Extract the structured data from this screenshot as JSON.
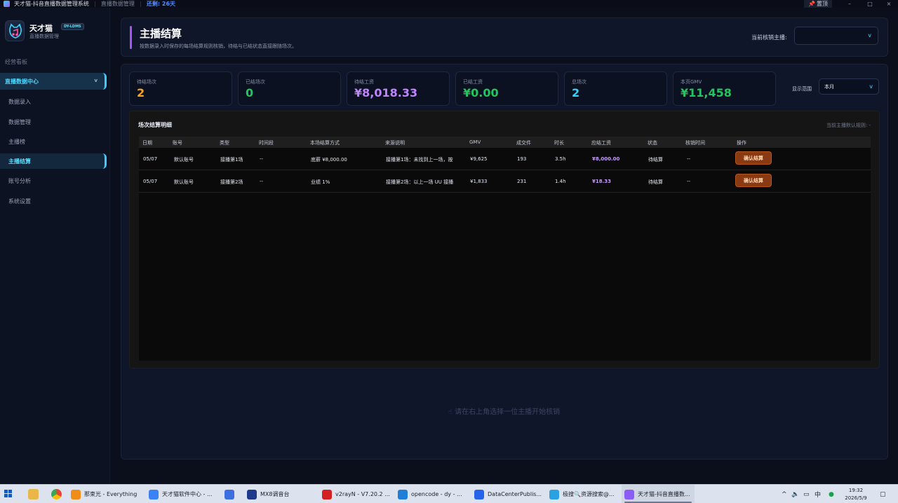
{
  "titlebar": {
    "app_title": "天才猫-抖音直播数据管理系统",
    "module": "直播数据管理",
    "remaining": "还剩: 26天",
    "pin_label": "置顶",
    "minimize": "–",
    "maximize": "□",
    "close": "×"
  },
  "brand": {
    "name": "天才猫",
    "tag": "DY-LDMS",
    "subtitle": "直播数据管理"
  },
  "sidebar": {
    "section_label": "经营看板",
    "group_label": "直播数据中心",
    "group_chevron": "v",
    "items": [
      {
        "label": "数据录入"
      },
      {
        "label": "数据管理"
      },
      {
        "label": "主播榜"
      },
      {
        "label": "主播结算"
      },
      {
        "label": "账号分析"
      },
      {
        "label": "系统设置"
      }
    ]
  },
  "header": {
    "title": "主播结算",
    "description": "按数据录入时保存的每场结算规则核销，待结与已结状态直接跟随场次。",
    "select_label": "当前核销主播:",
    "select_value": "",
    "select_caret": "v",
    "accent_color": "#a855f7"
  },
  "stats": [
    {
      "label": "待结场次",
      "value": "2",
      "color": "#f5a524"
    },
    {
      "label": "已结场次",
      "value": "0",
      "color": "#22c55e"
    },
    {
      "label": "待结工资",
      "value": "¥8,018.33",
      "color": "#c084fc"
    },
    {
      "label": "已结工资",
      "value": "¥0.00",
      "color": "#22c55e"
    },
    {
      "label": "总场次",
      "value": "2",
      "color": "#38d0f5"
    },
    {
      "label": "本页GMV",
      "value": "¥11,458",
      "color": "#22c55e"
    }
  ],
  "range": {
    "label": "显示范围",
    "value": "本月",
    "caret": "v"
  },
  "table_panel": {
    "title": "场次结算明细",
    "rule_note": "当前主播默认规则: -"
  },
  "table": {
    "columns": [
      "日期",
      "账号",
      "类型",
      "时间段",
      "本场结算方式",
      "来源说明",
      "GMV",
      "成交件",
      "时长",
      "应结工资",
      "状态",
      "核销时间",
      "操作"
    ],
    "rows": [
      {
        "date": "05/07",
        "account": "默认账号",
        "type": "接播第1场",
        "time_slot": "--",
        "method": "底薪 ¥8,000.00",
        "source": "接播第1场：未找到上一场，按",
        "gmv": "¥9,625",
        "orders": "193",
        "duration": "3.5h",
        "salary": "¥8,000.00",
        "status": "待结算",
        "verify_time": "--",
        "action": "确认结算"
      },
      {
        "date": "05/07",
        "account": "默认账号",
        "type": "接播第2场",
        "time_slot": "--",
        "method": "业绩 1%",
        "source": "接播第2场：以上一场 UU 接播",
        "gmv": "¥1,833",
        "orders": "231",
        "duration": "1.4h",
        "salary": "¥18.33",
        "status": "待结算",
        "verify_time": "--",
        "action": "确认结算"
      }
    ]
  },
  "hint": "请在右上角选择一位主播开始核销",
  "taskbar": {
    "apps": [
      {
        "label": "那束光 - Everything",
        "icon": "everything-icon",
        "color": "#f28c18"
      },
      {
        "label": "天才猫软件中心 - ...",
        "icon": "chrome-icon",
        "color": "#3b82f6"
      },
      {
        "label": "",
        "icon": "chat-icon",
        "color": "#3d6fe0"
      },
      {
        "label": "MX8调音台",
        "icon": "mixer-icon",
        "color": "#1e3a8a"
      },
      {
        "label": "v2rayN - V7.20.2 ...",
        "icon": "v2ray-icon",
        "color": "#d42020"
      },
      {
        "label": "opencode - dy - ...",
        "icon": "vscode-icon",
        "color": "#1f7fd6"
      },
      {
        "label": "DataCenterPublis...",
        "icon": "window-icon",
        "color": "#2563eb"
      },
      {
        "label": "极搜🔍资源搜索@...",
        "icon": "telegram-icon",
        "color": "#2aa1e0"
      },
      {
        "label": "天才猫-抖音直播数...",
        "icon": "app-icon",
        "color": "#8b5cf6"
      }
    ],
    "tray_ime": "中",
    "time": "19:32",
    "date": "2026/5/9"
  }
}
